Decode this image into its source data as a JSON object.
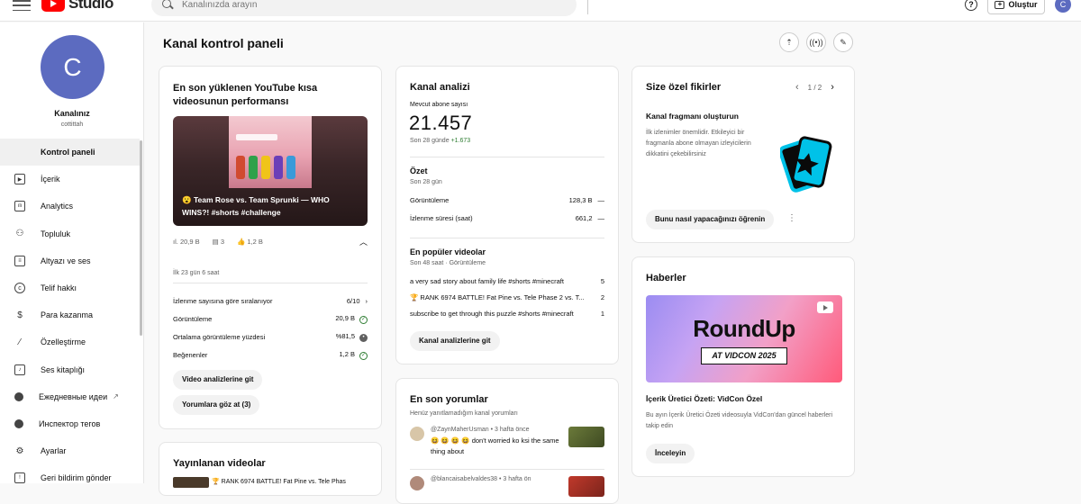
{
  "topbar": {
    "logo_text": "Studio",
    "search_placeholder": "Kanalınızda arayın",
    "help_label": "?",
    "create_label": "Oluştur",
    "avatar_letter": "C"
  },
  "sidebar": {
    "avatar_letter": "C",
    "channel_name": "Kanalınız",
    "channel_handle": "cottittah",
    "items": [
      {
        "label": "Kontrol paneli",
        "icon": "dashboard-icon"
      },
      {
        "label": "İçerik",
        "icon": "content-icon"
      },
      {
        "label": "Analytics",
        "icon": "analytics-icon"
      },
      {
        "label": "Topluluk",
        "icon": "community-icon"
      },
      {
        "label": "Altyazı ve ses",
        "icon": "subtitles-icon"
      },
      {
        "label": "Telif hakkı",
        "icon": "copyright-icon"
      },
      {
        "label": "Para kazanma",
        "icon": "dollar-icon"
      },
      {
        "label": "Özelleştirme",
        "icon": "magic-wand-icon"
      },
      {
        "label": "Ses kitaplığı",
        "icon": "audio-library-icon"
      },
      {
        "label": "Ежедневные идеи",
        "icon": "ideas-icon"
      },
      {
        "label": "Инспектор тегов",
        "icon": "tag-inspector-icon"
      },
      {
        "label": "Ayarlar",
        "icon": "gear-icon"
      },
      {
        "label": "Geri bildirim gönder",
        "icon": "feedback-icon"
      }
    ]
  },
  "main": {
    "title": "Kanal kontrol paneli"
  },
  "shorts_card": {
    "title": "En son yüklenen YouTube kısa videosunun performansı",
    "video_caption": "😮 Team Rose vs. Team Sprunki — WHO WINS?! #shorts #challenge",
    "stat_views": "20,9 B",
    "stat_comments": "3",
    "stat_likes": "1,2 B",
    "period": "İlk 23 gün 6 saat",
    "rows": [
      {
        "label": "İzlenme sayısına göre sıralanıyor",
        "value": "6/10"
      },
      {
        "label": "Görüntüleme",
        "value": "20,9 B"
      },
      {
        "label": "Ortalama görüntüleme yüzdesi",
        "value": "%81,5"
      },
      {
        "label": "Beğenenler",
        "value": "1,2 B"
      }
    ],
    "btn_analytics": "Video analizlerine git",
    "btn_comments": "Yorumlara göz at (3)"
  },
  "published_card": {
    "title": "Yayınlanan videolar",
    "first_item": "🏆 RANK 6974 BATTLE! Fat Pine vs. Tele Phas"
  },
  "analytics_card": {
    "title": "Kanal analizi",
    "subs_label": "Mevcut abone sayısı",
    "subs_value": "21.457",
    "subs_change_prefix": "Son 28 günde",
    "subs_change": "+1.673",
    "summary_title": "Özet",
    "summary_period": "Son 28 gün",
    "summary_rows": [
      {
        "label": "Görüntüleme",
        "value": "128,3 B",
        "trend": "—"
      },
      {
        "label": "İzlenme süresi (saat)",
        "value": "661,2",
        "trend": "—"
      }
    ],
    "popular_title": "En popüler videolar",
    "popular_period": "Son 48 saat · Görüntüleme",
    "popular_rows": [
      {
        "label": "a very sad story about family life #shorts #minecraft",
        "value": "5"
      },
      {
        "label": "🏆 RANK 6974 BATTLE! Fat Pine vs. Tele Phase 2 vs. T...",
        "value": "2"
      },
      {
        "label": "subscribe to get through this puzzle #shorts #minecraft",
        "value": "1"
      }
    ],
    "btn": "Kanal analizlerine git"
  },
  "comments_card": {
    "title": "En son yorumlar",
    "subtitle": "Henüz yanıtlamadığım kanal yorumları",
    "comments": [
      {
        "author": "@ZaynMaherUsman",
        "time": "• 3 hafta önce",
        "text": "😆 😆 😆 😆  don't worried ko ksi the same thing about"
      },
      {
        "author": "@blancaisabelvaldes38",
        "time": "• 3 hafta ön"
      }
    ]
  },
  "ideas_card": {
    "title": "Size özel fikirler",
    "pager": "1 / 2",
    "idea_title": "Kanal fragmanı oluşturun",
    "idea_text": "İlk izlenimler önemlidir. Etkileyici bir fragmanla abone olmayan izleyicilerin dikkatini çekebilirsiniz",
    "btn": "Bunu nasıl yapacağınızı öğrenin",
    "accent": "#00c2e8"
  },
  "news_card": {
    "title": "Haberler",
    "banner_word": "RoundUp",
    "banner_tag": "AT VIDCON 2025",
    "headline": "İçerik Üretici Özeti: VidCon Özel",
    "text": "Bu ayın İçerik Üretici Özeti videosuyla VidCon'dan güncel haberleri takip edin",
    "btn": "İnceleyin"
  }
}
